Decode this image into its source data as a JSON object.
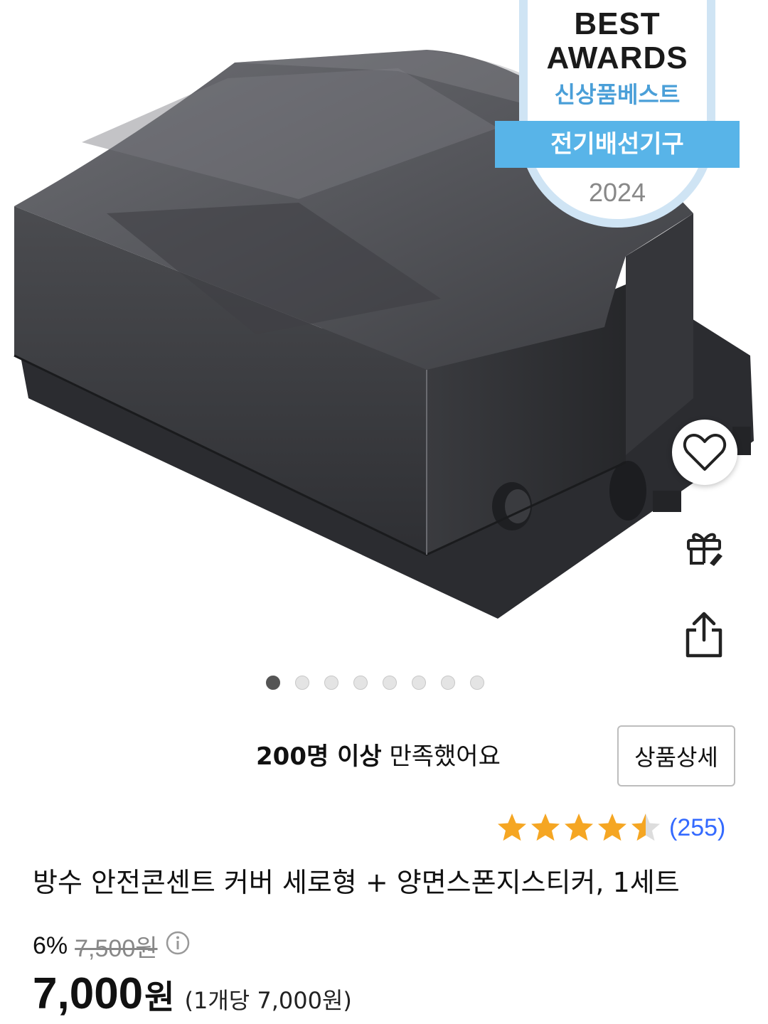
{
  "award": {
    "line1": "BEST",
    "line2": "AWARDS",
    "subtitle": "신상품베스트",
    "category": "전기배선기구",
    "year": "2024"
  },
  "gallery": {
    "total_images": 8,
    "active_index": 0
  },
  "actions": {
    "wishlist_icon": "heart-icon",
    "gift_icon": "gift-icon",
    "share_icon": "share-icon"
  },
  "satisfaction": {
    "count": "200명 이상",
    "text": "만족했어요"
  },
  "detail_button_label": "상품상세",
  "rating": {
    "stars": 4.5,
    "review_count": "(255)",
    "star_color": "#f5a623"
  },
  "product": {
    "title": "방수 안전콘센트 커버 세로형 + 양면스폰지스티커, 1세트"
  },
  "price": {
    "discount": "6%",
    "original": "7,500원",
    "sale": "7,000",
    "currency": "원",
    "unit_price": "(1개당 7,000원)"
  },
  "colors": {
    "review_link": "#346aff",
    "award_blue": "#58b4e8"
  }
}
